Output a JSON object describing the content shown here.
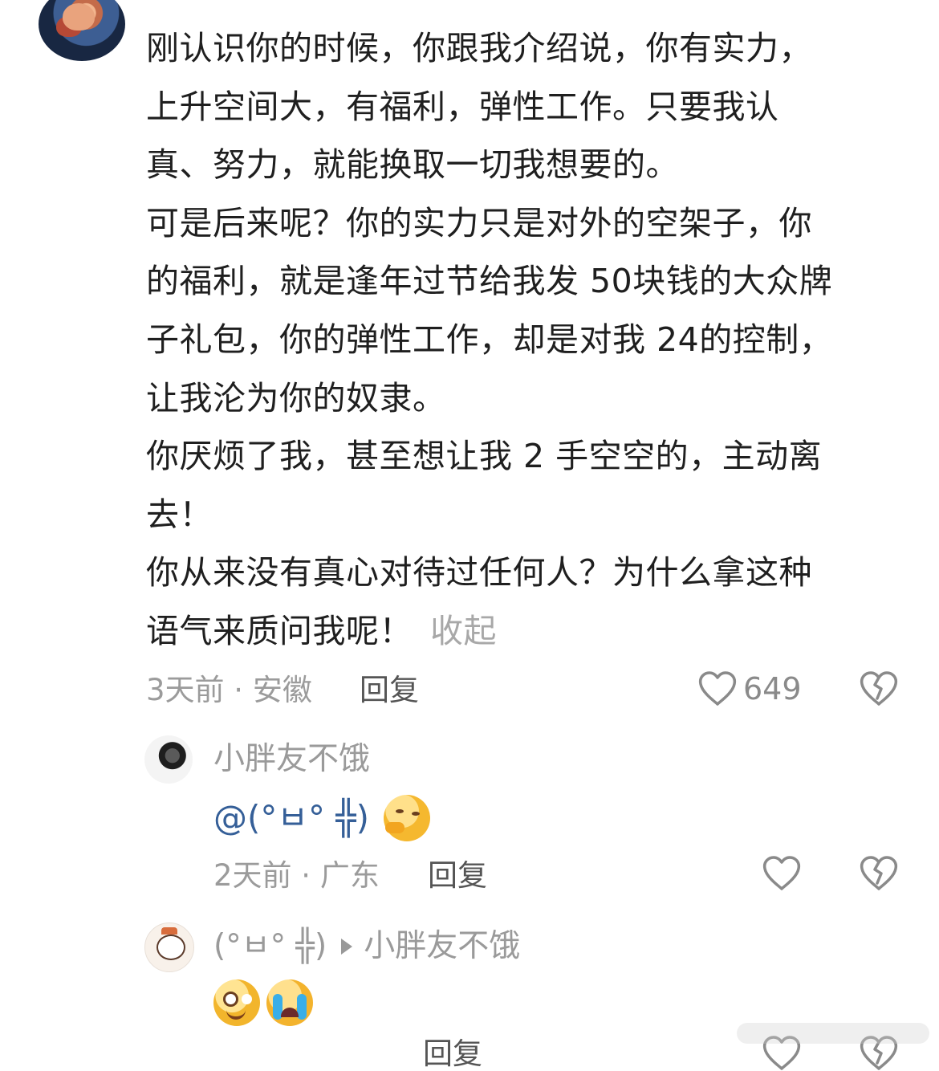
{
  "comment": {
    "paragraphs": [
      "刚认识你的时候，你跟我介绍说，你有实力，\n上升空间大，有福利，弹性工作。只要我认\n真、努力，就能换取一切我想要的。",
      "可是后来呢？你的实力只是对外的空架子，你\n的福利，就是逢年过节给我发 50块钱的大众牌\n子礼包，你的弹性工作，却是对我 24的控制，\n让我沦为你的奴隶。",
      "你厌烦了我，甚至想让我 2 手空空的，主动离\n去！",
      "你从来没有真心对待过任何人？为什么拿这种\n语气来质问我呢！"
    ],
    "collapse_label": "收起",
    "meta": "3天前 · 安徽",
    "reply_label": "回复",
    "like_count": "649"
  },
  "replies": [
    {
      "author": "小胖友不饿",
      "mention": "@(°ㅂ° ╬)",
      "meta": "2天前 · 广东",
      "reply_label": "回复"
    },
    {
      "author": "(°ㅂ° ╬)",
      "target": "小胖友不饿",
      "meta": "",
      "reply_label": "回复"
    }
  ],
  "icons": {
    "like": "heart-outline-icon",
    "dislike": "broken-heart-icon",
    "reply_arrow": "triangle-right-icon"
  },
  "colors": {
    "text": "#1f1f1f",
    "muted": "#9b9b9b",
    "mention": "#355f98",
    "collapse": "#a8a8a8"
  }
}
